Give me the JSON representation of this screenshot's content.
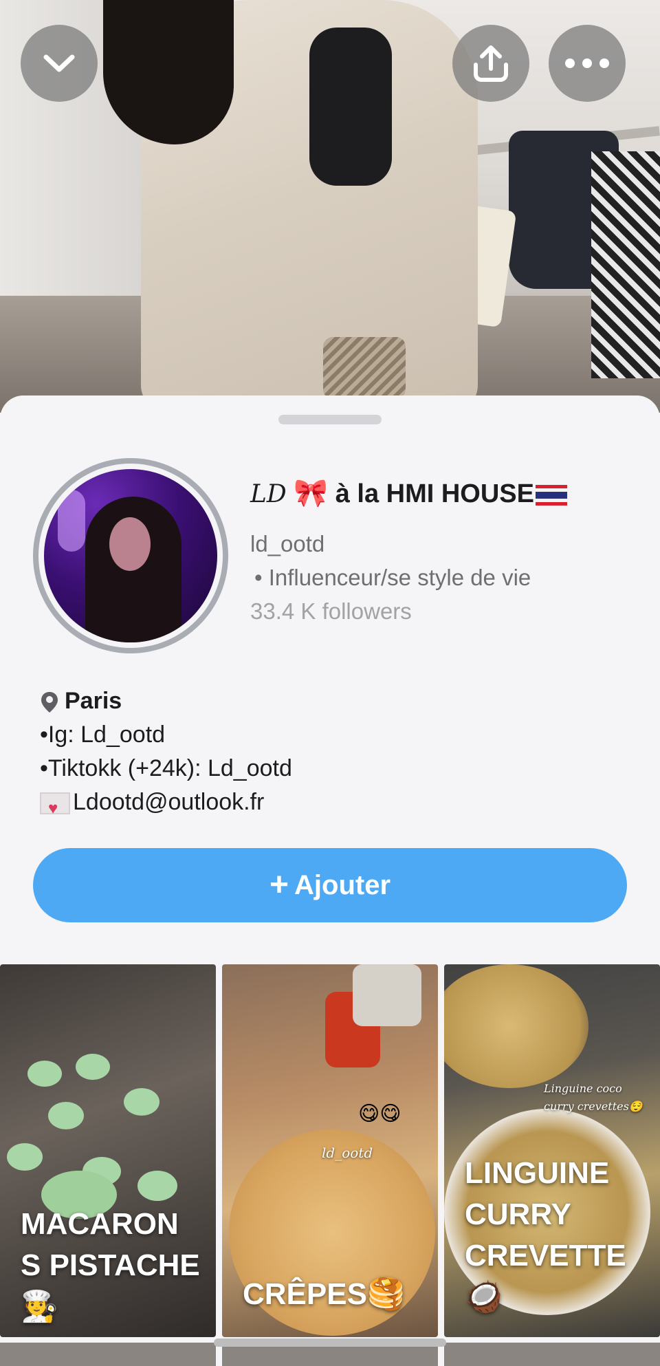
{
  "header": {
    "back_icon": "chevron-down-icon",
    "share_icon": "share-icon",
    "more_icon": "more-icon"
  },
  "profile": {
    "name_prefix": "LD",
    "name_bow": "🎀",
    "name_text": " à la HMI HOUSE",
    "username": "ld_ootd",
    "category": "• Influenceur/se style de vie",
    "followers": "33.4 K followers"
  },
  "bio": {
    "location": "Paris",
    "line_ig": "•Ig: Ld_ootd",
    "line_tiktok": "•Tiktokk (+24k): Ld_ootd",
    "email": "Ldootd@outlook.fr"
  },
  "actions": {
    "add_label": "Ajouter",
    "add_plus": "+"
  },
  "stories": [
    {
      "title_line1": "MACARON",
      "title_line2": "S PISTACHE",
      "emoji": "🧑‍🍳"
    },
    {
      "title": "CRÊPES",
      "emoji_top": "😋😋",
      "emoji_title": "🥞",
      "watermark": "ld_ootd"
    },
    {
      "title_line1": "LINGUINE",
      "title_line2": "CURRY",
      "title_line3": "CREVETTE",
      "caption": "Linguine coco curry crevettes😌",
      "emoji": "🥥"
    }
  ],
  "colors": {
    "accent": "#4ea9f4",
    "sheet_bg": "#f5f5f7",
    "muted_text": "#6e6e73",
    "followers_text": "#a1a1a6"
  }
}
